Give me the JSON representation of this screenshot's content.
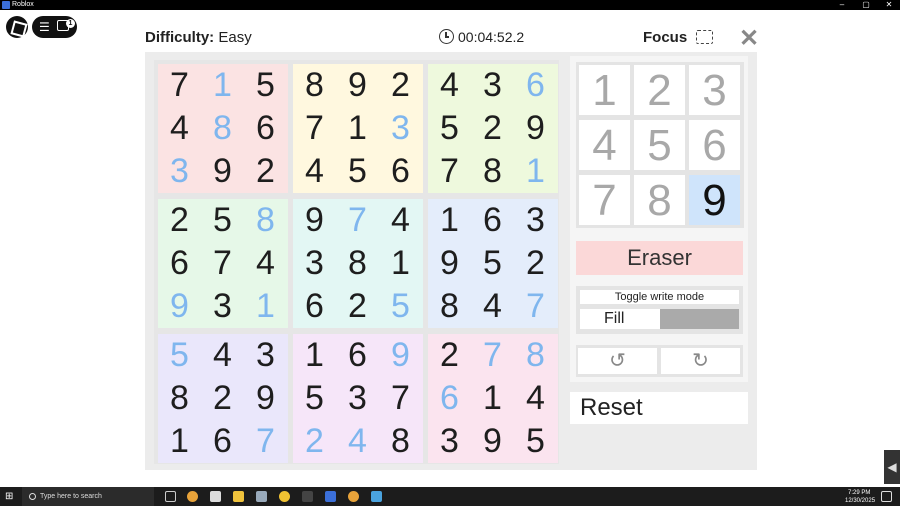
{
  "window": {
    "title": "Roblox",
    "minimize": "–",
    "maximize": "▢",
    "close": "✕"
  },
  "roblox_menu": {
    "badge": "1"
  },
  "header": {
    "difficulty_label": "Difficulty:",
    "difficulty_value": "Easy",
    "timer": "00:04:52.2",
    "focus_label": "Focus",
    "close": "✕"
  },
  "board": {
    "box_colors": [
      [
        "#fbe3e3",
        "#fff8df",
        "#eef9dd"
      ],
      [
        "#e6f8e8",
        "#e3f7f4",
        "#e4edfb"
      ],
      [
        "#eae7fb",
        "#f6e6f9",
        "#fbe4ef"
      ]
    ],
    "rows": [
      [
        "7",
        "1",
        "5",
        "8",
        "9",
        "2",
        "4",
        "3",
        "6"
      ],
      [
        "4",
        "8",
        "6",
        "7",
        "1",
        "3",
        "5",
        "2",
        "9"
      ],
      [
        "3",
        "9",
        "2",
        "4",
        "5",
        "6",
        "7",
        "8",
        "1"
      ],
      [
        "2",
        "5",
        "8",
        "9",
        "7",
        "4",
        "1",
        "6",
        "3"
      ],
      [
        "6",
        "7",
        "4",
        "3",
        "8",
        "1",
        "9",
        "5",
        "2"
      ],
      [
        "9",
        "3",
        "1",
        "6",
        "2",
        "5",
        "8",
        "4",
        "7"
      ],
      [
        "5",
        "4",
        "3",
        "1",
        "6",
        "9",
        "2",
        "7",
        "8"
      ],
      [
        "8",
        "2",
        "9",
        "5",
        "3",
        "7",
        "6",
        "1",
        "4"
      ],
      [
        "1",
        "6",
        "7",
        "2",
        "4",
        "8",
        "3",
        "9",
        "5"
      ]
    ],
    "blue_cells": [
      [
        0,
        1
      ],
      [
        0,
        8
      ],
      [
        1,
        1
      ],
      [
        1,
        5
      ],
      [
        2,
        0
      ],
      [
        2,
        8
      ],
      [
        3,
        2
      ],
      [
        3,
        4
      ],
      [
        5,
        0
      ],
      [
        5,
        2
      ],
      [
        5,
        5
      ],
      [
        5,
        8
      ],
      [
        6,
        0
      ],
      [
        6,
        5
      ],
      [
        6,
        7
      ],
      [
        6,
        8
      ],
      [
        7,
        6
      ],
      [
        8,
        2
      ],
      [
        8,
        3
      ],
      [
        8,
        4
      ]
    ]
  },
  "number_pad": {
    "keys": [
      "1",
      "2",
      "3",
      "4",
      "5",
      "6",
      "7",
      "8",
      "9"
    ],
    "selected": "9"
  },
  "controls": {
    "eraser": "Eraser",
    "toggle_label": "Toggle write mode",
    "mode": "Fill",
    "undo": "↺",
    "redo": "↻",
    "reset": "Reset"
  },
  "taskbar": {
    "search_placeholder": "Type here to search",
    "time": "7:29 PM",
    "date": "12/30/2025"
  }
}
